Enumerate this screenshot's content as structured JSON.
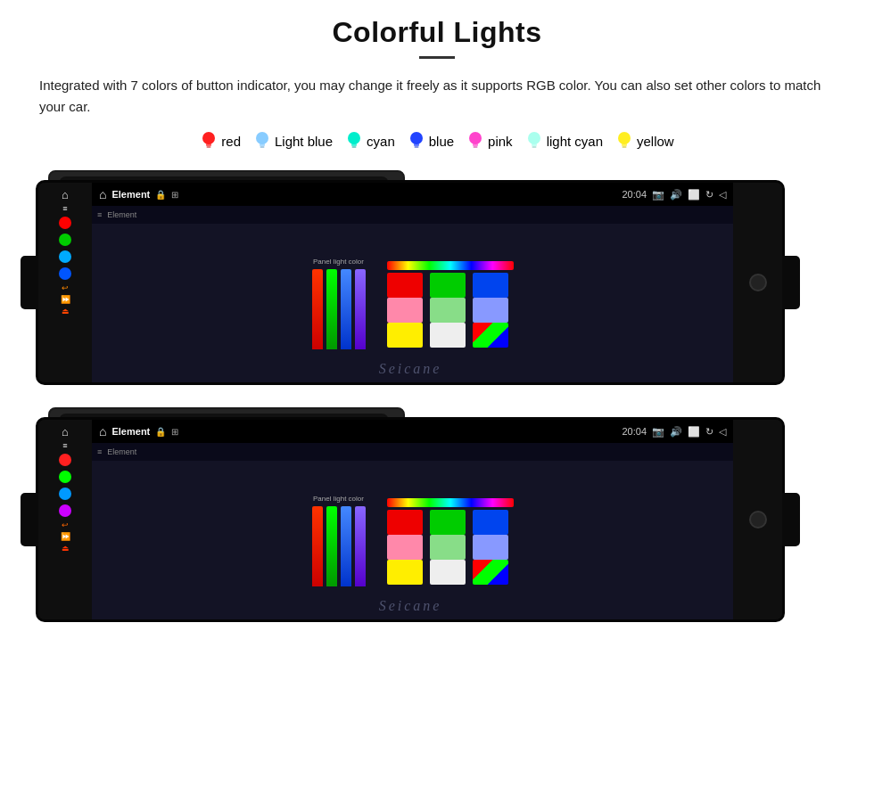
{
  "header": {
    "title": "Colorful Lights",
    "divider": true
  },
  "description": "Integrated with 7 colors of button indicator, you may change it freely as it supports RGB color. You can also set other colors to match your car.",
  "colors": [
    {
      "name": "red",
      "color": "#ff2020",
      "text_color": "#222"
    },
    {
      "name": "Light blue",
      "color": "#88ccff",
      "text_color": "#222"
    },
    {
      "name": "cyan",
      "color": "#00ffee",
      "text_color": "#222"
    },
    {
      "name": "blue",
      "color": "#2244ff",
      "text_color": "#222"
    },
    {
      "name": "pink",
      "color": "#ff44cc",
      "text_color": "#222"
    },
    {
      "name": "light cyan",
      "color": "#aaffee",
      "text_color": "#222"
    },
    {
      "name": "yellow",
      "color": "#ffee22",
      "text_color": "#222"
    }
  ],
  "devices": {
    "screen_title": "Element",
    "screen_time": "20:04",
    "panel_label": "Panel light color",
    "watermark": "Seicane",
    "color_grid": [
      "#ff0000",
      "#00cc00",
      "#0044ff",
      "#ff6688",
      "#44cc44",
      "#6688ff",
      "#ffee00",
      "#ffffff",
      "linear-gradient(45deg,#f00,#0f0,#00f)"
    ]
  }
}
